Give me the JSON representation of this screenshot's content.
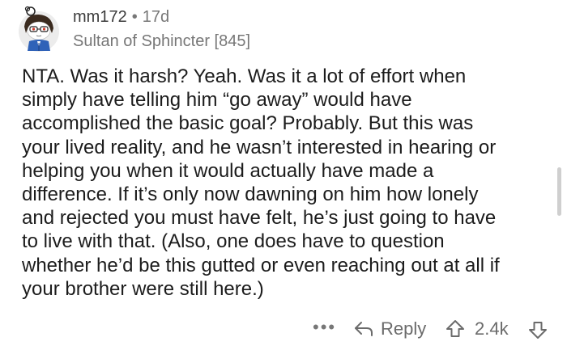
{
  "comment": {
    "username": "mm172",
    "separator": "•",
    "age": "17d",
    "flair": "Sultan of Sphincter [845]",
    "avatar_icon": "snoo-avatar-icon",
    "body_lines": [
      "NTA.  Was it harsh?  Yeah.  Was it a lot of effort when",
      "simply have telling him “go away” would have",
      "accomplished the basic goal?  Probably.  But this was",
      "your lived reality, and he wasn’t interested in hearing or",
      "helping you when it would actually have made a",
      "difference.  If it’s only now dawning on him how lonely",
      "and rejected you must have felt, he’s just going to have",
      "to live with that.  (Also, one does have to question",
      "whether he’d be this gutted or even reaching out at all if",
      "your brother were still here.)"
    ]
  },
  "actions": {
    "more": "•••",
    "reply_label": "Reply",
    "score": "2.4k"
  },
  "icons": {
    "more": "more-options-icon",
    "reply": "reply-arrow-icon",
    "upvote": "upvote-arrow-icon",
    "downvote": "downvote-arrow-icon"
  },
  "colors": {
    "text": "#1c1c1c",
    "meta": "#777777",
    "action": "#6b6b6b"
  }
}
